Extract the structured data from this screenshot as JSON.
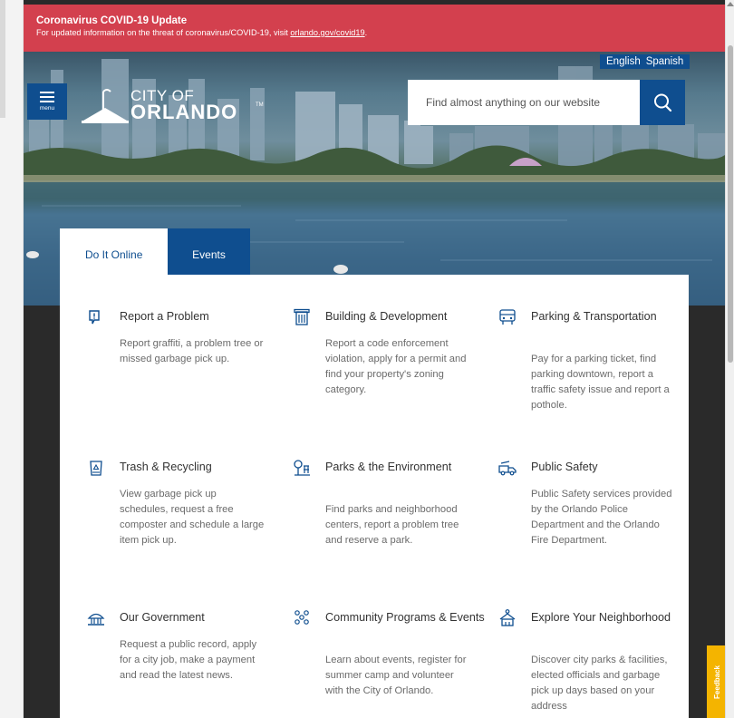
{
  "alert": {
    "title": "Coronavirus COVID-19 Update",
    "text": "For updated information on the threat of coronavirus/COVID-19, visit ",
    "link_text": "orlando.gov/covid19",
    "text_end": ".",
    "bg_color": "#d3404e"
  },
  "languages": [
    "English",
    "Spanish"
  ],
  "menu_label": "menu",
  "logo": {
    "line1": "CITY OF",
    "line2": "ORLANDO",
    "tm": "TM"
  },
  "search": {
    "placeholder": "Find almost anything on our website",
    "icon": "search-icon"
  },
  "tabs": [
    {
      "label": "Do It Online",
      "active": true
    },
    {
      "label": "Events",
      "active": false
    }
  ],
  "cards": [
    {
      "title": "Report a Problem",
      "desc": "Report graffiti, a problem tree or missed garbage pick up.",
      "icon": "report-problem-icon"
    },
    {
      "title": "Building & Development",
      "desc": "Report a code enforcement violation, apply for a permit and find your property's zoning category.",
      "icon": "building-icon"
    },
    {
      "title": "Parking & Transportation",
      "desc": "Pay for a parking ticket, find parking downtown, report a traffic safety issue and report a pothole.",
      "icon": "parking-icon"
    },
    {
      "title": "Trash & Recycling",
      "desc": "View garbage pick up schedules, request a free composter and schedule a large item pick up.",
      "icon": "trash-icon"
    },
    {
      "title": "Parks & the Environment",
      "desc": "Find parks and neighborhood centers, report a problem tree and reserve a park.",
      "icon": "parks-icon"
    },
    {
      "title": "Public Safety",
      "desc": "Public Safety services provided by the Orlando Police Department and the Orlando Fire Department.",
      "icon": "fire-truck-icon"
    },
    {
      "title": "Our Government",
      "desc": "Request a public record, apply for a city job, make a payment and read the latest news.",
      "icon": "government-icon"
    },
    {
      "title": "Community Programs & Events",
      "desc": "Learn about events, register for summer camp and volunteer with the City of Orlando.",
      "icon": "community-icon"
    },
    {
      "title": "Explore Your Neighborhood",
      "desc": "Discover city parks & facilities, elected officials and garbage pick up days based on your address",
      "icon": "neighborhood-icon"
    }
  ],
  "feedback_label": "Feedback",
  "colors": {
    "brand_blue": "#0f4e8f",
    "feedback": "#f4b400"
  }
}
